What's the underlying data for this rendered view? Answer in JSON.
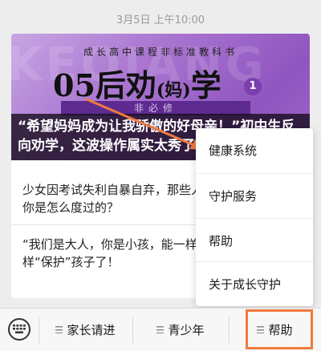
{
  "timestamp": "3月5日 上午10:00",
  "article": {
    "banner": {
      "watermark": "KEQIANG",
      "subtitle": "成长高中课程非标准教科书",
      "title_part1": "05后劝",
      "title_part2": "(妈)",
      "title_part3": "学",
      "number": "1",
      "tag": "非必修",
      "headline_line1": "“希望妈妈成为让我骄傲的好母亲！”初中生反",
      "headline_line2": "向劝学，这波操作属实太秀了"
    },
    "item1": "少女因考试失利自暴自弃，那些人生中最暗时刻，你是怎么度过的？",
    "item2": "“我们是大人，你是小孩，能一样吗？”不要再这样“保护”孩子了！"
  },
  "popup_menu": {
    "items": [
      "健康系统",
      "守护服务",
      "帮助",
      "关于成长守护"
    ]
  },
  "bottom_menu": {
    "items": [
      "家长请进",
      "青少年",
      "帮助"
    ]
  },
  "colors": {
    "highlight": "#f07a3e",
    "arrow": "#f07a3e"
  }
}
